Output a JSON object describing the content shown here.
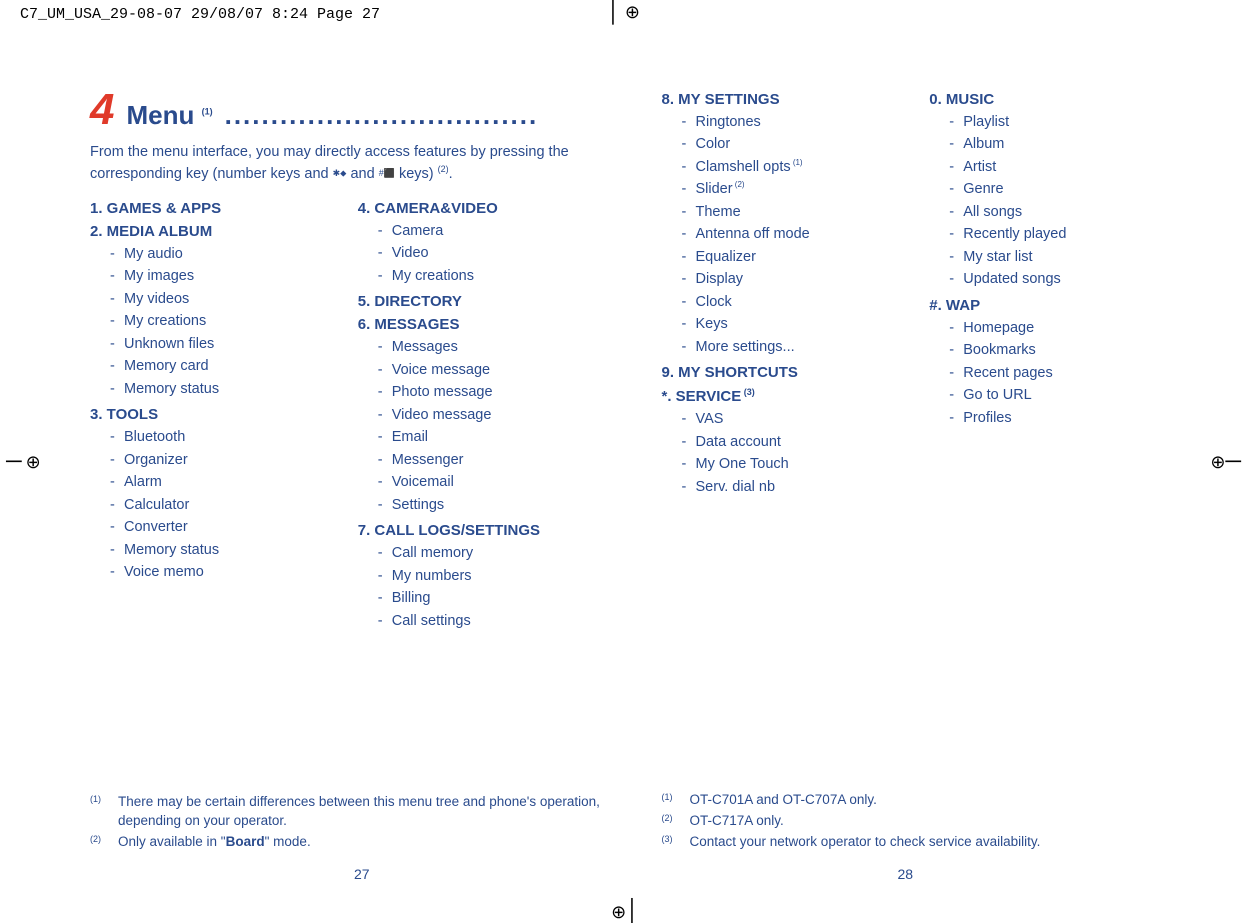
{
  "header_line": "C7_UM_USA_29-08-07  29/08/07  8:24  Page 27",
  "chapter": {
    "num": "4",
    "title": "Menu",
    "title_sup": "(1)",
    "dots": ".................................."
  },
  "intro": {
    "part1": "From the menu interface, you may directly access features by pressing the corresponding key (number keys and ",
    "icon1": "✱⬥",
    "mid": " and ",
    "icon2": "#⬛",
    "part2": " keys) ",
    "sup": "(2)",
    "end": "."
  },
  "left_cols": [
    [
      {
        "title": "1. GAMES & APPS",
        "items": []
      },
      {
        "title": "2. MEDIA ALBUM",
        "items": [
          "My audio",
          "My images",
          "My videos",
          "My creations",
          "Unknown files",
          "Memory card",
          "Memory status"
        ]
      },
      {
        "title": "3. TOOLS",
        "items": [
          "Bluetooth",
          "Organizer",
          "Alarm",
          "Calculator",
          "Converter",
          "Memory status",
          "Voice memo"
        ]
      }
    ],
    [
      {
        "title": "4. CAMERA&VIDEO",
        "items": [
          "Camera",
          "Video",
          "My creations"
        ]
      },
      {
        "title": "5. DIRECTORY",
        "items": []
      },
      {
        "title": "6. MESSAGES",
        "items": [
          "Messages",
          "Voice message",
          "Photo message",
          "Video message",
          "Email",
          "Messenger",
          "Voicemail",
          "Settings"
        ]
      },
      {
        "title": "7. CALL LOGS/SETTINGS",
        "items": [
          "Call memory",
          "My numbers",
          "Billing",
          "Call settings"
        ]
      }
    ]
  ],
  "right_cols": [
    [
      {
        "title": "8. MY SETTINGS",
        "items": [
          {
            "t": "Ringtones"
          },
          {
            "t": "Color"
          },
          {
            "t": "Clamshell opts",
            "sup": "(1)"
          },
          {
            "t": "Slider",
            "sup": "(2)"
          },
          {
            "t": "Theme"
          },
          {
            "t": "Antenna off mode"
          },
          {
            "t": "Equalizer"
          },
          {
            "t": "Display"
          },
          {
            "t": "Clock"
          },
          {
            "t": "Keys"
          },
          {
            "t": "More settings..."
          }
        ]
      },
      {
        "title": "9. MY SHORTCUTS",
        "items": []
      },
      {
        "title": "*. SERVICE",
        "title_sup": "(3)",
        "items": [
          {
            "t": "VAS"
          },
          {
            "t": "Data account"
          },
          {
            "t": "My One Touch"
          },
          {
            "t": "Serv. dial nb"
          }
        ]
      }
    ],
    [
      {
        "title": "0. MUSIC",
        "items": [
          {
            "t": "Playlist"
          },
          {
            "t": "Album"
          },
          {
            "t": "Artist"
          },
          {
            "t": "Genre"
          },
          {
            "t": "All songs"
          },
          {
            "t": "Recently played"
          },
          {
            "t": "My star list"
          },
          {
            "t": "Updated songs"
          }
        ]
      },
      {
        "title": "#. WAP",
        "items": [
          {
            "t": "Homepage"
          },
          {
            "t": "Bookmarks"
          },
          {
            "t": "Recent pages"
          },
          {
            "t": "Go to URL"
          },
          {
            "t": "Profiles"
          }
        ]
      }
    ]
  ],
  "footnotes_left": [
    {
      "mark": "(1)",
      "text": "There may be certain differences between this menu tree and phone's operation, depending on your operator."
    },
    {
      "mark": "(2)",
      "text_pre": "Only available in \"",
      "bold": "Board",
      "text_post": "\" mode."
    }
  ],
  "footnotes_right": [
    {
      "mark": "(1)",
      "text": "OT-C701A and OT-C707A only."
    },
    {
      "mark": "(2)",
      "text": "OT-C717A only."
    },
    {
      "mark": "(3)",
      "text": "Contact your network operator to check service availability."
    }
  ],
  "pagenum_left": "27",
  "pagenum_right": "28"
}
